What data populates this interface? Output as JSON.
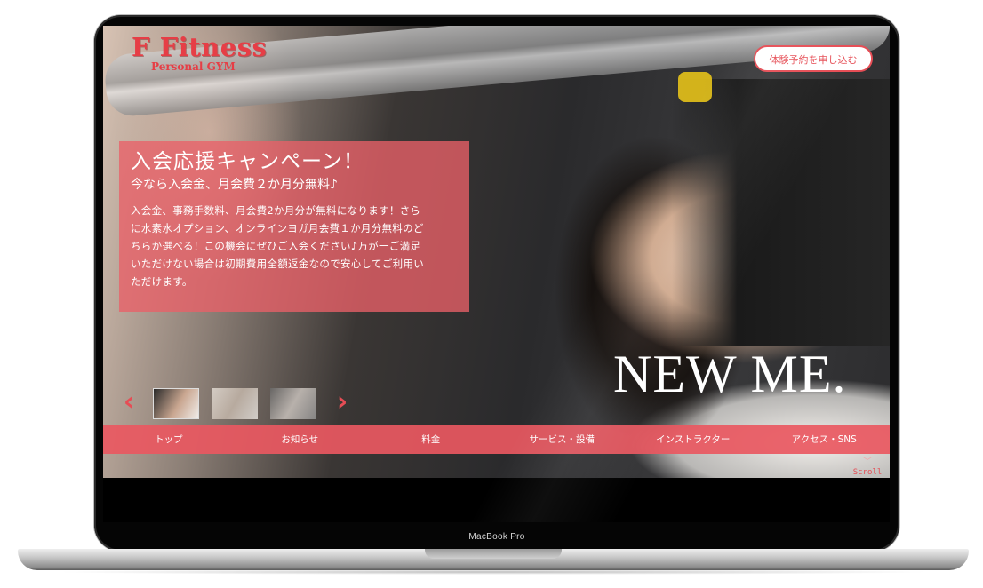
{
  "device": {
    "label": "MacBook Pro"
  },
  "header": {
    "logo_main": "F Fitness",
    "logo_sub": "Personal GYM",
    "cta_label": "体験予約を申し込む"
  },
  "campaign": {
    "title": "入会応援キャンペーン！",
    "subtitle": "今なら入会金、月会費２か月分無料♪",
    "body_lines": [
      "入会金、事務手数料、月会費2か月分が無料になります！さら",
      "に水素水オプション、オンラインヨガ月会費１か月分無料のど",
      "ちらか選べる！この機会にぜひご入会ください♪万が一ご満足",
      "いただけない場合は初期費用全額返金なので安心してご利用い",
      "ただけます。"
    ]
  },
  "slider": {
    "prev_glyph": "‹",
    "next_glyph": "›",
    "active_index": 1,
    "count": 3
  },
  "hero": {
    "tagline": "NEW ME."
  },
  "nav": {
    "items": [
      {
        "label": "トップ"
      },
      {
        "label": "お知らせ"
      },
      {
        "label": "料金"
      },
      {
        "label": "サービス・設備"
      },
      {
        "label": "インストラクター"
      },
      {
        "label": "アクセス・SNS"
      }
    ]
  },
  "scroll": {
    "label": "Scroll",
    "icon": "chevron-down-icon"
  },
  "colors": {
    "accent": "#e64d55",
    "panel": "#e96068",
    "nav": "#e95861",
    "bezel": "#050505"
  }
}
